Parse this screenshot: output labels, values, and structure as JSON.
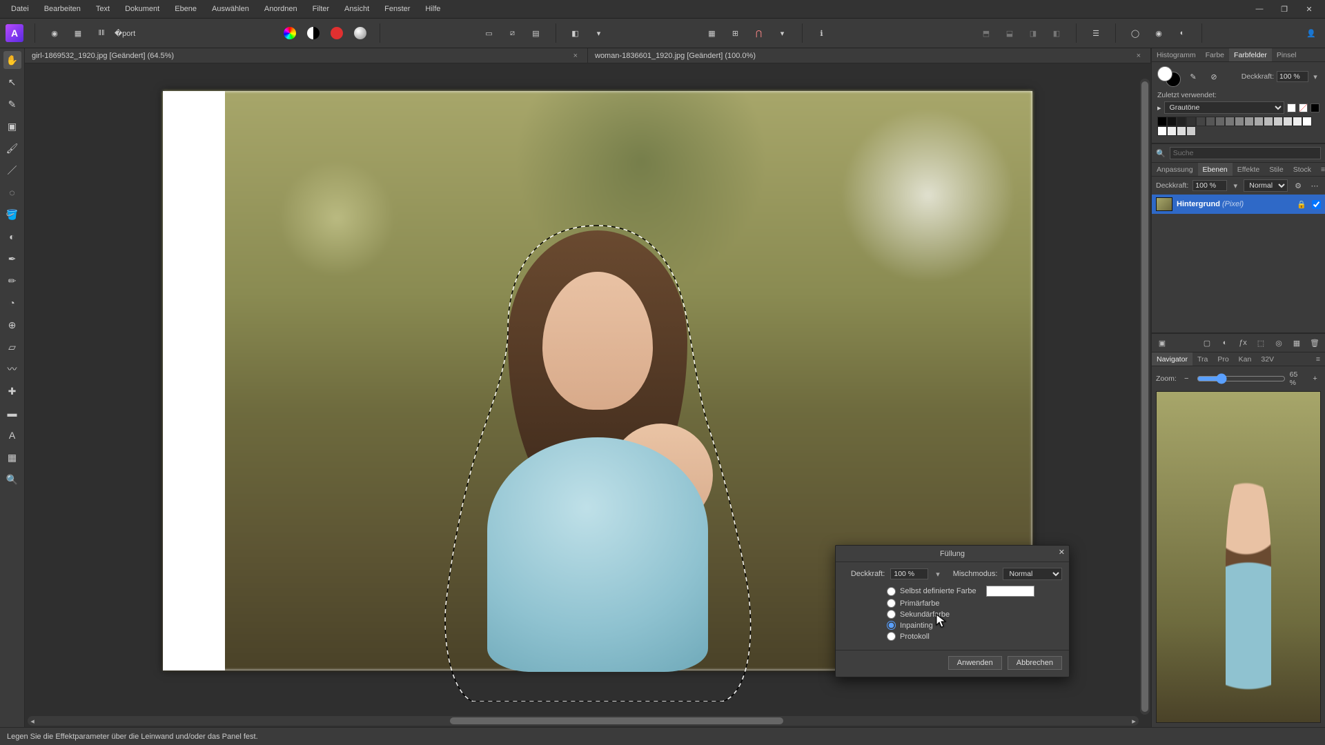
{
  "menu": {
    "items": [
      "Datei",
      "Bearbeiten",
      "Text",
      "Dokument",
      "Ebene",
      "Auswählen",
      "Anordnen",
      "Filter",
      "Ansicht",
      "Fenster",
      "Hilfe"
    ]
  },
  "window_controls": {
    "min": "—",
    "max": "❐",
    "close": "✕"
  },
  "tabs": [
    {
      "label": "girl-1869532_1920.jpg [Geändert] (64.5%)"
    },
    {
      "label": "woman-1836601_1920.jpg [Geändert] (100.0%)"
    }
  ],
  "right": {
    "top_tabs": [
      "Histogramm",
      "Farbe",
      "Farbfelder",
      "Pinsel"
    ],
    "top_active": "Farbfelder",
    "opacity_label": "Deckkraft:",
    "opacity_value": "100 %",
    "recent_label": "Zuletzt verwendet:",
    "palette_name": "Grautöne",
    "search_placeholder": "Suche",
    "mid_tabs": [
      "Anpassung",
      "Ebenen",
      "Effekte",
      "Stile",
      "Stock"
    ],
    "mid_active": "Ebenen",
    "layers_opacity_label": "Deckkraft:",
    "layers_opacity_value": "100 %",
    "blend_label": "Normal",
    "layer_name": "Hintergrund",
    "layer_kind": "(Pixel)",
    "nav_tabs": [
      "Navigator",
      "Tra",
      "Pro",
      "Kan",
      "32V"
    ],
    "nav_active": "Navigator",
    "zoom_label": "Zoom:",
    "zoom_value": "65 %"
  },
  "dialog": {
    "title": "Füllung",
    "opacity_label": "Deckkraft:",
    "opacity_value": "100 %",
    "blend_label": "Mischmodus:",
    "blend_value": "Normal",
    "options": {
      "custom": "Selbst definierte Farbe",
      "primary": "Primärfarbe",
      "secondary": "Sekundärfarbe",
      "inpainting": "Inpainting",
      "protocol": "Protokoll"
    },
    "apply": "Anwenden",
    "cancel": "Abbrechen"
  },
  "status": "Legen Sie die Effektparameter über die Leinwand und/oder das Panel fest."
}
